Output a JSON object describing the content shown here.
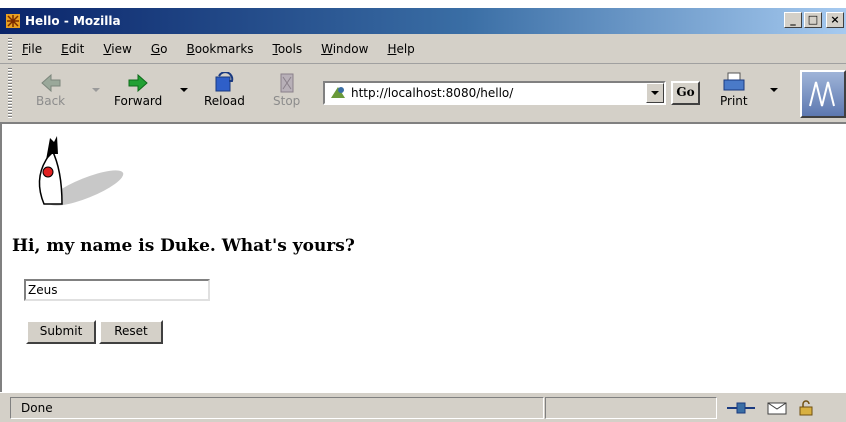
{
  "window": {
    "title": "Hello - Mozilla",
    "minimize": "_",
    "maximize": "□",
    "close": "×"
  },
  "menu": [
    {
      "underline": "F",
      "rest": "ile"
    },
    {
      "underline": "E",
      "rest": "dit"
    },
    {
      "underline": "V",
      "rest": "iew"
    },
    {
      "underline": "G",
      "rest": "o"
    },
    {
      "underline": "B",
      "rest": "ookmarks"
    },
    {
      "underline": "T",
      "rest": "ools"
    },
    {
      "underline": "W",
      "rest": "indow"
    },
    {
      "underline": "H",
      "rest": "elp"
    }
  ],
  "toolbar": {
    "back": "Back",
    "forward": "Forward",
    "reload": "Reload",
    "stop": "Stop",
    "url": "http://localhost:8080/hello/",
    "go": "Go",
    "print": "Print"
  },
  "page": {
    "greeting": "Hi, my name is Duke. What's yours?",
    "name_value": "Zeus",
    "submit": "Submit",
    "reset": "Reset"
  },
  "status": {
    "text": "Done"
  },
  "icons": {
    "app": "mozilla-icon",
    "back": "back-arrow-icon",
    "forward": "forward-arrow-icon",
    "reload": "reload-icon",
    "stop": "stop-icon",
    "site": "site-icon",
    "print": "printer-icon",
    "throbber": "mozilla-throbber-icon",
    "duke": "duke-mascot-image",
    "connection": "connection-icon",
    "security": "padlock-icon"
  },
  "colors": {
    "titlebar_start": "#0a246a",
    "titlebar_end": "#a6caf0",
    "chrome": "#d4d0c8",
    "forward_green": "#22a033",
    "reload_blue": "#2f5fc8"
  }
}
